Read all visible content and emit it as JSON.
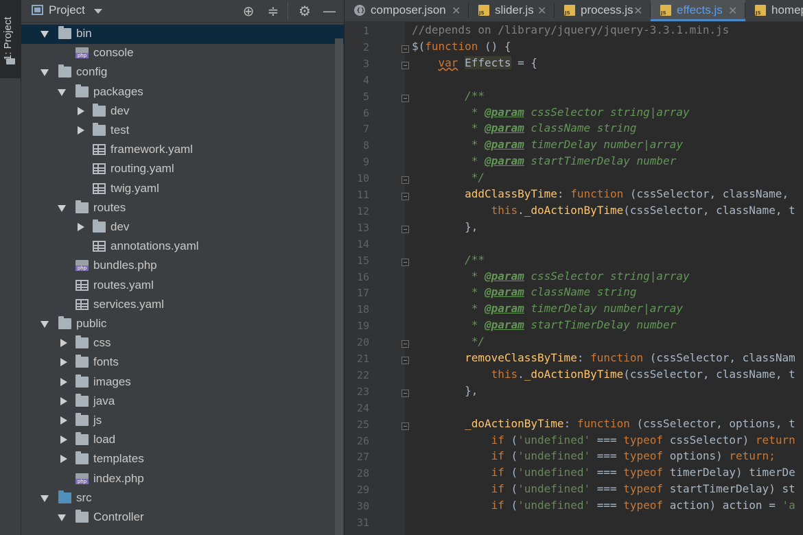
{
  "sidebar": {
    "tab_label": "1: Project"
  },
  "project_panel": {
    "title": "Project",
    "tree": [
      {
        "label": "bin",
        "type": "folder",
        "depth": 0,
        "expanded": true,
        "selected": true
      },
      {
        "label": "console",
        "type": "php",
        "depth": 1
      },
      {
        "label": "config",
        "type": "folder",
        "depth": 0,
        "expanded": true
      },
      {
        "label": "packages",
        "type": "folder",
        "depth": 1,
        "expanded": true
      },
      {
        "label": "dev",
        "type": "folder",
        "depth": 2,
        "expanded": false
      },
      {
        "label": "test",
        "type": "folder",
        "depth": 2,
        "expanded": false
      },
      {
        "label": "framework.yaml",
        "type": "yaml",
        "depth": 2
      },
      {
        "label": "routing.yaml",
        "type": "yaml",
        "depth": 2
      },
      {
        "label": "twig.yaml",
        "type": "yaml",
        "depth": 2
      },
      {
        "label": "routes",
        "type": "folder",
        "depth": 1,
        "expanded": true
      },
      {
        "label": "dev",
        "type": "folder",
        "depth": 2,
        "expanded": false
      },
      {
        "label": "annotations.yaml",
        "type": "yaml",
        "depth": 2
      },
      {
        "label": "bundles.php",
        "type": "php",
        "depth": 1
      },
      {
        "label": "routes.yaml",
        "type": "yaml",
        "depth": 1
      },
      {
        "label": "services.yaml",
        "type": "yaml",
        "depth": 1
      },
      {
        "label": "public",
        "type": "folder",
        "depth": 0,
        "expanded": true
      },
      {
        "label": "css",
        "type": "folder",
        "depth": 1,
        "expanded": false
      },
      {
        "label": "fonts",
        "type": "folder",
        "depth": 1,
        "expanded": false
      },
      {
        "label": "images",
        "type": "folder",
        "depth": 1,
        "expanded": false
      },
      {
        "label": "java",
        "type": "folder",
        "depth": 1,
        "expanded": false
      },
      {
        "label": "js",
        "type": "folder",
        "depth": 1,
        "expanded": false
      },
      {
        "label": "load",
        "type": "folder",
        "depth": 1,
        "expanded": false
      },
      {
        "label": "templates",
        "type": "folder",
        "depth": 1,
        "expanded": false
      },
      {
        "label": "index.php",
        "type": "php",
        "depth": 1
      },
      {
        "label": "src",
        "type": "folder-blue",
        "depth": 0,
        "expanded": true
      },
      {
        "label": "Controller",
        "type": "folder",
        "depth": 1,
        "expanded": true
      }
    ]
  },
  "tabs": [
    {
      "label": "composer.json",
      "icon": "json-icon",
      "active": false
    },
    {
      "label": "slider.js",
      "icon": "js-file-icon",
      "active": false
    },
    {
      "label": "process.js",
      "icon": "js-file-icon",
      "active": false
    },
    {
      "label": "effects.js",
      "icon": "js-file-icon",
      "active": true
    },
    {
      "label": "homep",
      "icon": "js-file-icon",
      "active": false
    }
  ],
  "editor": {
    "lines": [
      [
        {
          "t": "//depends on /library/jquery/jquery-3.3.1.min.js",
          "c": "comment"
        }
      ],
      [
        {
          "t": "$",
          "c": ""
        },
        {
          "t": "(",
          "c": ""
        },
        {
          "t": "function",
          "c": "kw"
        },
        {
          "t": " () {",
          "c": ""
        }
      ],
      [
        {
          "t": "    ",
          "c": ""
        },
        {
          "t": "var",
          "c": "squig"
        },
        {
          "t": " ",
          "c": ""
        },
        {
          "t": "Effects",
          "c": "hl"
        },
        {
          "t": " = {",
          "c": ""
        }
      ],
      [],
      [
        {
          "t": "        /**",
          "c": "doc"
        }
      ],
      [
        {
          "t": "         * ",
          "c": "doc"
        },
        {
          "t": "@param",
          "c": "doctag"
        },
        {
          "t": " cssSelector string|array",
          "c": "doc"
        }
      ],
      [
        {
          "t": "         * ",
          "c": "doc"
        },
        {
          "t": "@param",
          "c": "doctag"
        },
        {
          "t": " className string",
          "c": "doc"
        }
      ],
      [
        {
          "t": "         * ",
          "c": "doc"
        },
        {
          "t": "@param",
          "c": "doctag"
        },
        {
          "t": " timerDelay number|array",
          "c": "doc"
        }
      ],
      [
        {
          "t": "         * ",
          "c": "doc"
        },
        {
          "t": "@param",
          "c": "doctag"
        },
        {
          "t": " startTimerDelay number",
          "c": "doc"
        }
      ],
      [
        {
          "t": "         */",
          "c": "doc"
        }
      ],
      [
        {
          "t": "        ",
          "c": ""
        },
        {
          "t": "addClassByTime",
          "c": "fn"
        },
        {
          "t": ": ",
          "c": ""
        },
        {
          "t": "function",
          "c": "kw"
        },
        {
          "t": " (cssSelector, className, ",
          "c": ""
        }
      ],
      [
        {
          "t": "            ",
          "c": ""
        },
        {
          "t": "this",
          "c": "kw"
        },
        {
          "t": ".",
          "c": ""
        },
        {
          "t": "_doActionByTime",
          "c": "fn"
        },
        {
          "t": "(cssSelector, className, t",
          "c": ""
        }
      ],
      [
        {
          "t": "        },",
          "c": ""
        }
      ],
      [],
      [
        {
          "t": "        /**",
          "c": "doc"
        }
      ],
      [
        {
          "t": "         * ",
          "c": "doc"
        },
        {
          "t": "@param",
          "c": "doctag"
        },
        {
          "t": " cssSelector string|array",
          "c": "doc"
        }
      ],
      [
        {
          "t": "         * ",
          "c": "doc"
        },
        {
          "t": "@param",
          "c": "doctag"
        },
        {
          "t": " className string",
          "c": "doc"
        }
      ],
      [
        {
          "t": "         * ",
          "c": "doc"
        },
        {
          "t": "@param",
          "c": "doctag"
        },
        {
          "t": " timerDelay number|array",
          "c": "doc"
        }
      ],
      [
        {
          "t": "         * ",
          "c": "doc"
        },
        {
          "t": "@param",
          "c": "doctag"
        },
        {
          "t": " startTimerDelay number",
          "c": "doc"
        }
      ],
      [
        {
          "t": "         */",
          "c": "doc"
        }
      ],
      [
        {
          "t": "        ",
          "c": ""
        },
        {
          "t": "removeClassByTime",
          "c": "fn"
        },
        {
          "t": ": ",
          "c": ""
        },
        {
          "t": "function",
          "c": "kw"
        },
        {
          "t": " (cssSelector, classNam",
          "c": ""
        }
      ],
      [
        {
          "t": "            ",
          "c": ""
        },
        {
          "t": "this",
          "c": "kw"
        },
        {
          "t": ".",
          "c": ""
        },
        {
          "t": "_doActionByTime",
          "c": "fn"
        },
        {
          "t": "(cssSelector, className, t",
          "c": ""
        }
      ],
      [
        {
          "t": "        },",
          "c": ""
        }
      ],
      [],
      [
        {
          "t": "        ",
          "c": ""
        },
        {
          "t": "_doActionByTime",
          "c": "fn"
        },
        {
          "t": ": ",
          "c": ""
        },
        {
          "t": "function",
          "c": "kw"
        },
        {
          "t": " (cssSelector, options, t",
          "c": ""
        }
      ],
      [
        {
          "t": "            ",
          "c": ""
        },
        {
          "t": "if",
          "c": "kw"
        },
        {
          "t": " (",
          "c": ""
        },
        {
          "t": "'undefined'",
          "c": "str"
        },
        {
          "t": " === ",
          "c": ""
        },
        {
          "t": "typeof",
          "c": "kw"
        },
        {
          "t": " cssSelector) ",
          "c": ""
        },
        {
          "t": "return",
          "c": "kw"
        }
      ],
      [
        {
          "t": "            ",
          "c": ""
        },
        {
          "t": "if",
          "c": "kw"
        },
        {
          "t": " (",
          "c": ""
        },
        {
          "t": "'undefined'",
          "c": "str"
        },
        {
          "t": " === ",
          "c": ""
        },
        {
          "t": "typeof",
          "c": "kw"
        },
        {
          "t": " options) ",
          "c": ""
        },
        {
          "t": "return",
          "c": "kw"
        },
        {
          "t": ";",
          "c": "kw"
        }
      ],
      [
        {
          "t": "            ",
          "c": ""
        },
        {
          "t": "if",
          "c": "kw"
        },
        {
          "t": " (",
          "c": ""
        },
        {
          "t": "'undefined'",
          "c": "str"
        },
        {
          "t": " === ",
          "c": ""
        },
        {
          "t": "typeof",
          "c": "kw"
        },
        {
          "t": " timerDelay) timerDe",
          "c": ""
        }
      ],
      [
        {
          "t": "            ",
          "c": ""
        },
        {
          "t": "if",
          "c": "kw"
        },
        {
          "t": " (",
          "c": ""
        },
        {
          "t": "'undefined'",
          "c": "str"
        },
        {
          "t": " === ",
          "c": ""
        },
        {
          "t": "typeof",
          "c": "kw"
        },
        {
          "t": " startTimerDelay) st",
          "c": ""
        }
      ],
      [
        {
          "t": "            ",
          "c": ""
        },
        {
          "t": "if",
          "c": "kw"
        },
        {
          "t": " (",
          "c": ""
        },
        {
          "t": "'undefined'",
          "c": "str"
        },
        {
          "t": " === ",
          "c": ""
        },
        {
          "t": "typeof",
          "c": "kw"
        },
        {
          "t": " action) action = ",
          "c": ""
        },
        {
          "t": "'a",
          "c": "str"
        }
      ],
      []
    ],
    "line_numbers": [
      "1",
      "2",
      "3",
      "4",
      "5",
      "6",
      "7",
      "8",
      "9",
      "10",
      "11",
      "12",
      "13",
      "14",
      "15",
      "16",
      "17",
      "18",
      "19",
      "20",
      "21",
      "22",
      "23",
      "24",
      "25",
      "26",
      "27",
      "28",
      "29",
      "30",
      "31"
    ],
    "fold_lines": [
      2,
      3,
      5,
      10,
      11,
      13,
      15,
      20,
      21,
      23,
      25
    ]
  }
}
